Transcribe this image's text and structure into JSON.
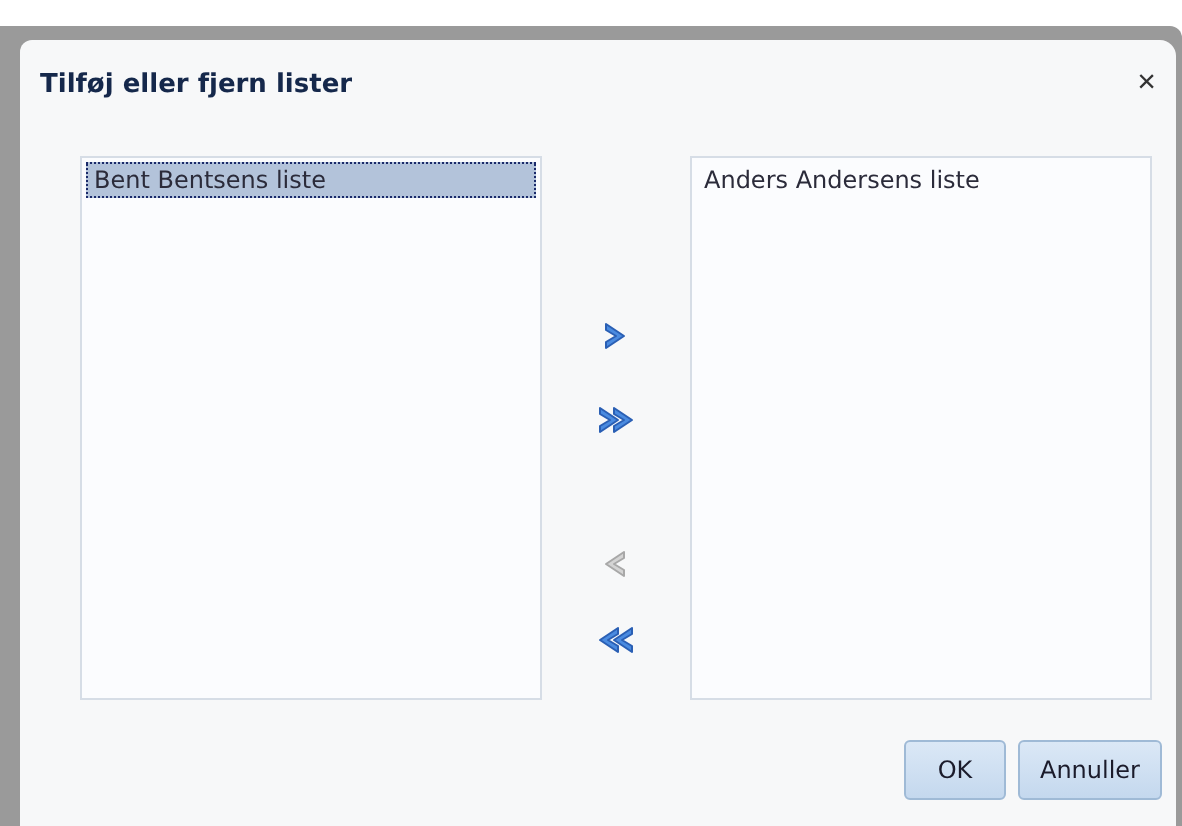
{
  "dialog": {
    "title": "Tilføj eller fjern lister",
    "close": "×"
  },
  "available": {
    "items": [
      {
        "label": "Bent Bentsens liste",
        "selected": true
      }
    ]
  },
  "chosen": {
    "items": [
      {
        "label": "Anders Andersens liste",
        "selected": false
      }
    ]
  },
  "arrows": [
    {
      "kind": "right",
      "disabled": false
    },
    {
      "kind": "rightall",
      "disabled": false
    },
    {
      "kind": "left",
      "disabled": true
    },
    {
      "kind": "leftall",
      "disabled": false
    }
  ],
  "buttons": [
    "OK",
    "Annuller"
  ]
}
